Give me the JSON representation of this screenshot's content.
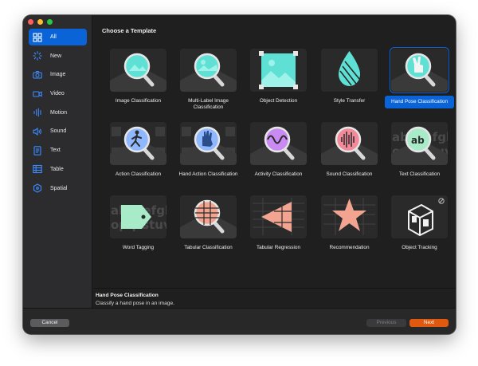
{
  "window": {
    "traffic_colors": [
      "#fe5f57",
      "#febc2e",
      "#28c840"
    ]
  },
  "sidebar": {
    "items": [
      {
        "label": "All",
        "icon": "grid-icon",
        "active": true
      },
      {
        "label": "New",
        "icon": "sparkle-icon",
        "active": false
      },
      {
        "label": "Image",
        "icon": "camera-icon",
        "active": false
      },
      {
        "label": "Video",
        "icon": "video-icon",
        "active": false
      },
      {
        "label": "Motion",
        "icon": "motion-icon",
        "active": false
      },
      {
        "label": "Sound",
        "icon": "speaker-icon",
        "active": false
      },
      {
        "label": "Text",
        "icon": "document-icon",
        "active": false
      },
      {
        "label": "Table",
        "icon": "table-icon",
        "active": false
      },
      {
        "label": "Spatial",
        "icon": "spatial-icon",
        "active": false
      }
    ]
  },
  "main": {
    "title": "Choose a Template",
    "templates": [
      {
        "label": "Image Classification",
        "art": "image-classification-icon"
      },
      {
        "label": "Multi-Label Image Classification",
        "art": "multi-label-image-icon"
      },
      {
        "label": "Object Detection",
        "art": "object-detection-icon"
      },
      {
        "label": "Style Transfer",
        "art": "style-transfer-icon"
      },
      {
        "label": "Hand Pose Classification",
        "art": "hand-pose-icon",
        "selected": true
      },
      {
        "label": "Action Classification",
        "art": "action-classification-icon"
      },
      {
        "label": "Hand Action Classification",
        "art": "hand-action-icon"
      },
      {
        "label": "Activity Classification",
        "art": "activity-classification-icon"
      },
      {
        "label": "Sound Classification",
        "art": "sound-classification-icon"
      },
      {
        "label": "Text Classification",
        "art": "text-classification-icon"
      },
      {
        "label": "Word Tagging",
        "art": "word-tagging-icon"
      },
      {
        "label": "Tabular Classification",
        "art": "tabular-classification-icon"
      },
      {
        "label": "Tabular Regression",
        "art": "tabular-regression-icon"
      },
      {
        "label": "Recommendation",
        "art": "recommendation-icon"
      },
      {
        "label": "Object Tracking",
        "art": "object-tracking-icon"
      }
    ]
  },
  "description": {
    "title": "Hand Pose Classification",
    "text": "Classify a hand pose in an image."
  },
  "footer": {
    "cancel_label": "Cancel",
    "previous_label": "Previous",
    "next_label": "Next"
  },
  "colors": {
    "accent": "#0a64d8",
    "next_button": "#e0590f",
    "teal": "#5fe0d4",
    "purple": "#c98bf2",
    "pink": "#f28a9a",
    "mint": "#a7ebc8",
    "salmon": "#f2a490"
  }
}
